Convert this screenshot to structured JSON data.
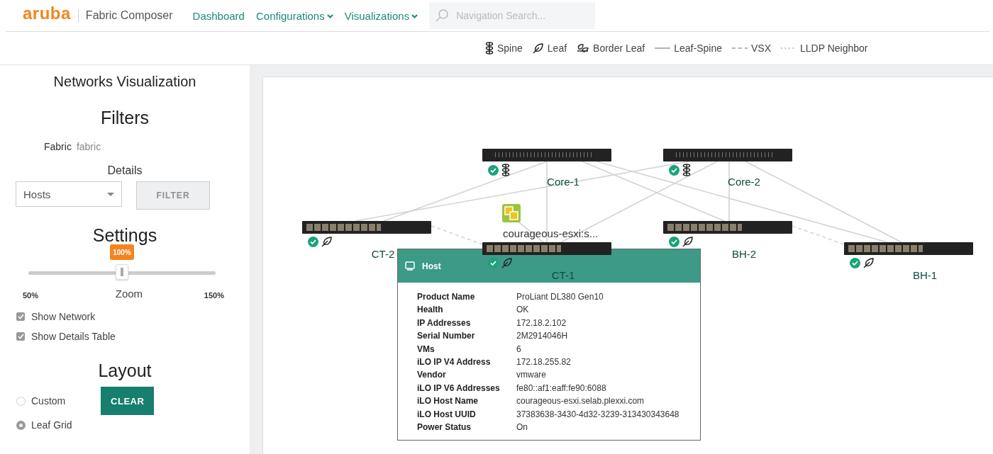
{
  "header": {
    "logo": "aruba",
    "app_name": "Fabric Composer",
    "nav": [
      {
        "label": "Dashboard",
        "dropdown": false
      },
      {
        "label": "Configurations",
        "dropdown": true
      },
      {
        "label": "Visualizations",
        "dropdown": true
      }
    ],
    "search": {
      "placeholder": "Navigation Search..."
    }
  },
  "legend": [
    {
      "kind": "spine",
      "label": "Spine"
    },
    {
      "kind": "leaf",
      "label": "Leaf"
    },
    {
      "kind": "border_leaf",
      "label": "Border Leaf"
    },
    {
      "kind": "solid",
      "label": "Leaf-Spine"
    },
    {
      "kind": "dashed",
      "label": "VSX"
    },
    {
      "kind": "dotted",
      "label": "LLDP Neighbor"
    }
  ],
  "sidebar": {
    "title": "Networks Visualization",
    "filters_heading": "Filters",
    "fabric_label": "Fabric",
    "fabric_value": "fabric",
    "details_label": "Details",
    "details_select": "Hosts",
    "filter_button": {
      "label": "FILTER",
      "disabled": true
    },
    "settings_heading": "Settings",
    "zoom": {
      "badge": "100%",
      "level": 0.5,
      "min": "50%",
      "label": "Zoom",
      "max": "150%"
    },
    "checkboxes": [
      {
        "label": "Show Network",
        "checked": true
      },
      {
        "label": "Show Details Table",
        "checked": true
      }
    ],
    "layout_heading": "Layout",
    "layout_options": [
      {
        "label": "Custom",
        "selected": false
      },
      {
        "label": "Leaf Grid",
        "selected": true
      }
    ],
    "clear_button": "CLEAR"
  },
  "topology": {
    "nodes": [
      {
        "label": "Core-1",
        "kind": "spine",
        "healthy": true
      },
      {
        "label": "Core-2",
        "kind": "spine",
        "healthy": true
      },
      {
        "label": "CT-2",
        "kind": "leaf",
        "healthy": true
      },
      {
        "label": "CT-1",
        "kind": "leaf",
        "healthy": true
      },
      {
        "label": "BH-2",
        "kind": "leaf",
        "healthy": true
      },
      {
        "label": "BH-1",
        "kind": "leaf",
        "healthy": true
      }
    ],
    "host": {
      "label": "courageous-esxi:s..."
    },
    "popup": {
      "title": "Host",
      "rows": [
        {
          "label": "Product Name",
          "value": "ProLiant DL380 Gen10"
        },
        {
          "label": "Health",
          "value": "OK"
        },
        {
          "label": "IP Addresses",
          "value": "172.18.2.102"
        },
        {
          "label": "Serial Number",
          "value": "2M2914046H"
        },
        {
          "label": "VMs",
          "value": "6"
        },
        {
          "label": "iLO IP V4 Address",
          "value": "172.18.255.82"
        },
        {
          "label": "Vendor",
          "value": "vmware"
        },
        {
          "label": "iLO IP V6 Addresses",
          "value": "fe80::af1:eaff:fe90:6088"
        },
        {
          "label": "iLO Host Name",
          "value": "courageous-esxi.selab.plexxi.com"
        },
        {
          "label": "iLO Host UUID",
          "value": "37383638-3430-4d32-3239-313430343648"
        },
        {
          "label": "Power Status",
          "value": "On"
        }
      ]
    }
  }
}
